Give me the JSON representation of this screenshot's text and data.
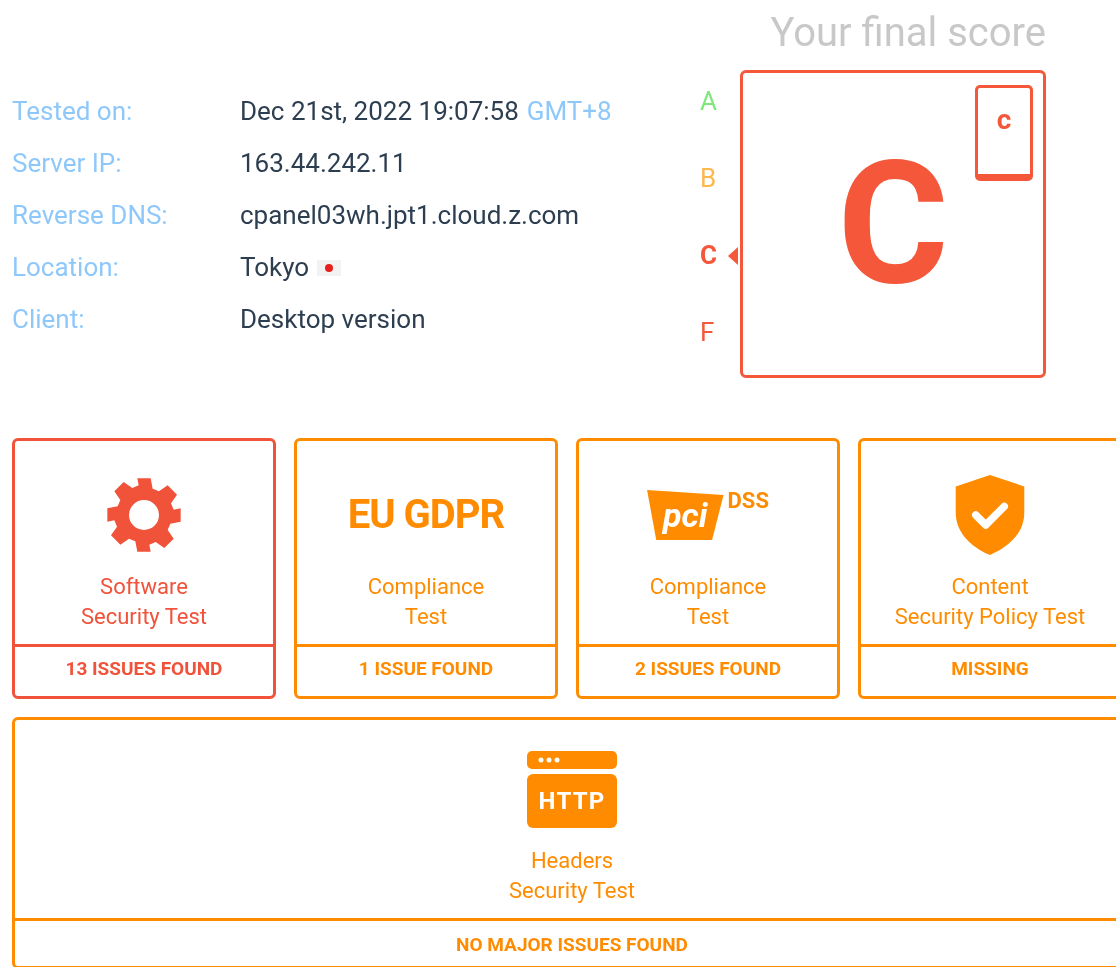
{
  "score_title": "Your final score",
  "info": [
    {
      "label": "Tested on:",
      "value": "Dec 21st, 2022 19:07:58",
      "extra": "GMT+8"
    },
    {
      "label": "Server IP:",
      "value": "163.44.242.11"
    },
    {
      "label": "Reverse DNS:",
      "value": "cpanel03wh.jpt1.cloud.z.com"
    },
    {
      "label": "Location:",
      "value": "Tokyo",
      "flag": true
    },
    {
      "label": "Client:",
      "value": "Desktop version"
    }
  ],
  "grades": [
    {
      "letter": "A",
      "color": "#7ee87a",
      "selected": false
    },
    {
      "letter": "B",
      "color": "#ffb74d",
      "selected": false
    },
    {
      "letter": "C",
      "color": "#f4573a",
      "selected": true
    },
    {
      "letter": "F",
      "color": "#f4573a",
      "selected": false
    }
  ],
  "score": {
    "grade": "C",
    "badge": "c",
    "color": "#f4573a"
  },
  "cards": [
    {
      "kind": "gear",
      "lines": [
        "Software",
        "Security Test"
      ],
      "result": "13 ISSUES FOUND",
      "color": "#f0523a"
    },
    {
      "kind": "gdpr",
      "logo": "EU GDPR",
      "lines": [
        "Compliance",
        "Test"
      ],
      "result": "1 ISSUE FOUND",
      "color": "#ff8c00"
    },
    {
      "kind": "pci",
      "logo": "pci",
      "logo_extra": "DSS",
      "lines": [
        "Compliance",
        "Test"
      ],
      "result": "2 ISSUES FOUND",
      "color": "#ff8c00"
    },
    {
      "kind": "shield",
      "lines": [
        "Content",
        "Security Policy Test"
      ],
      "result": "MISSING",
      "color": "#ff8c00"
    }
  ],
  "wide_card": {
    "kind": "http",
    "logo": "HTTP",
    "lines": [
      "Headers",
      "Security Test"
    ],
    "result": "NO MAJOR ISSUES FOUND",
    "color": "#ff8c00"
  }
}
